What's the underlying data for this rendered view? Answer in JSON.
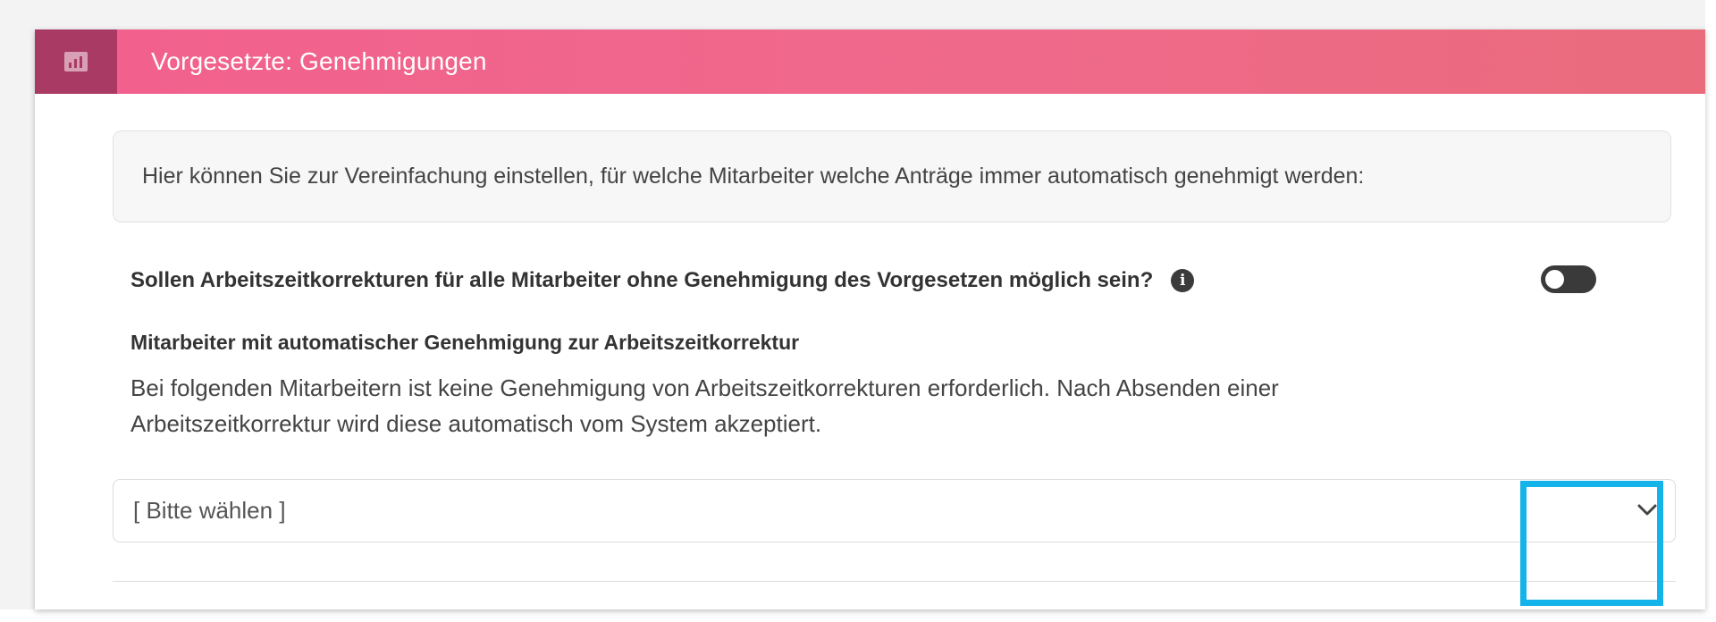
{
  "panel": {
    "title": "Vorgesetzte: Genehmigungen",
    "header_icon": "chart-icon",
    "accent_color": "#f0628c",
    "icon_bg_color": "#a83a63"
  },
  "info_box": {
    "text": "Hier können Sie zur Vereinfachung einstellen, für welche Mitarbeiter welche Anträge immer automatisch genehmigt werden:"
  },
  "setting": {
    "question": "Sollen Arbeitszeitkorrekturen für alle Mitarbeiter ohne Genehmigung des Vorgesetzen möglich sein?",
    "info_icon": "info-icon",
    "toggle_state": "off"
  },
  "auto_approval": {
    "title": "Mitarbeiter mit automatischer Genehmigung zur Arbeitszeitkorrektur",
    "description": "Bei folgenden Mitarbeitern ist keine Genehmigung von Arbeitszeitkorrekturen erforderlich. Nach Absenden einer Arbeitszeitkorrektur wird diese automatisch vom System akzeptiert.",
    "select_value": "[ Bitte wählen ]",
    "select_icon": "chevron-down-icon"
  },
  "annotation": {
    "highlight_color": "#14b3ea"
  }
}
